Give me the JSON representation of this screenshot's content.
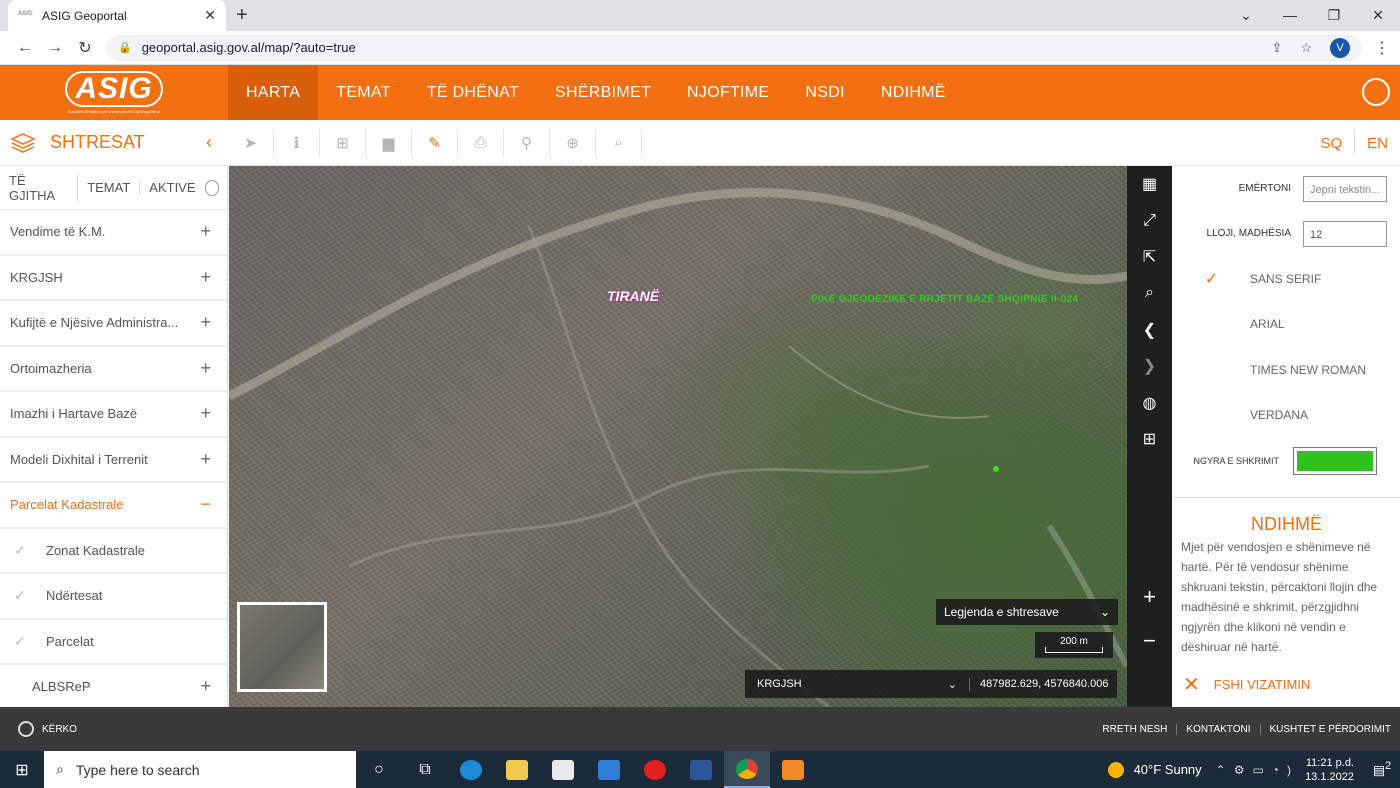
{
  "browser": {
    "tab_title": "ASIG Geoportal",
    "tab_favicon": "ASIG",
    "url": "geoportal.asig.gov.al/map/?auto=true",
    "profile_initial": "V"
  },
  "header": {
    "logo": "ASIG",
    "logo_subtitle": "Autoriteti Shtetëror për Informacionin Gjeohapësinor",
    "nav": [
      "HARTA",
      "TEMAT",
      "TË DHËNAT",
      "SHËRBIMET",
      "NJOFTIME",
      "NSDI",
      "NDIHMË"
    ],
    "active_nav": "HARTA"
  },
  "toolbar": {
    "layers_title": "SHTRESAT",
    "lang_sq": "SQ",
    "lang_en": "EN"
  },
  "sidebar": {
    "tabs": [
      "TË GJITHA",
      "TEMAT",
      "AKTIVE"
    ],
    "layers": [
      {
        "label": "Vendime të K.M.",
        "toggle": "+"
      },
      {
        "label": "KRGJSH",
        "toggle": "+"
      },
      {
        "label": "Kufijtë e Njësive Administra...",
        "toggle": "+"
      },
      {
        "label": "Ortoimazheria",
        "toggle": "+"
      },
      {
        "label": "Imazhi i Hartave Bazë",
        "toggle": "+"
      },
      {
        "label": "Modeli Dixhital i Terrenit",
        "toggle": "+"
      },
      {
        "label": "Parcelat Kadastrale",
        "toggle": "−"
      }
    ],
    "sublayers": [
      "Zonat Kadastrale",
      "Ndërtesat",
      "Parcelat"
    ],
    "last_layer": {
      "label": "ALBSReP",
      "toggle": "+"
    }
  },
  "map": {
    "city_label": "TIRANË",
    "green_label": "PIKË GJEODEZIKE E RRJETIT BAZË SHQIPNIE II-024",
    "legend_label": "Legjenda e shtresave",
    "scale_label": "200 m",
    "projection": "KRGJSH",
    "coordinates": "487982.629, 4576840.006"
  },
  "right_panel": {
    "name_label": "EMËRTONI",
    "name_placeholder": "Jepni tekstin...",
    "size_label": "LLOJI, MADHËSIA",
    "size_value": "12",
    "fonts": [
      "SANS SERIF",
      "ARIAL",
      "TIMES NEW ROMAN",
      "VERDANA"
    ],
    "selected_font": "SANS SERIF",
    "color_label": "NGYRA E SHKRIMIT",
    "color_value": "#2ec21c",
    "help_title": "NDIHMË",
    "help_text": "Mjet për vendosjen e shënimeve në hartë. Për të vendosur shënime shkruani tekstin, përcaktoni llojin dhe madhësinë e shkrimit, përzgjidhni ngjyrën dhe klikoni në vendin e dëshiruar në hartë.",
    "clear_label": "FSHI VIZATIMIN"
  },
  "footer": {
    "search_label": "KËRKO",
    "links": [
      "RRETH NESH",
      "KONTAKTONI",
      "KUSHTET E PËRDORIMIT"
    ]
  },
  "taskbar": {
    "search_placeholder": "Type here to search",
    "weather": "40°F  Sunny",
    "time": "11:21 p.d.",
    "date": "13.1.2022",
    "notifications": "2"
  },
  "colors": {
    "brand_orange": "#f26f12",
    "taskbar": "#1c2b3a"
  }
}
